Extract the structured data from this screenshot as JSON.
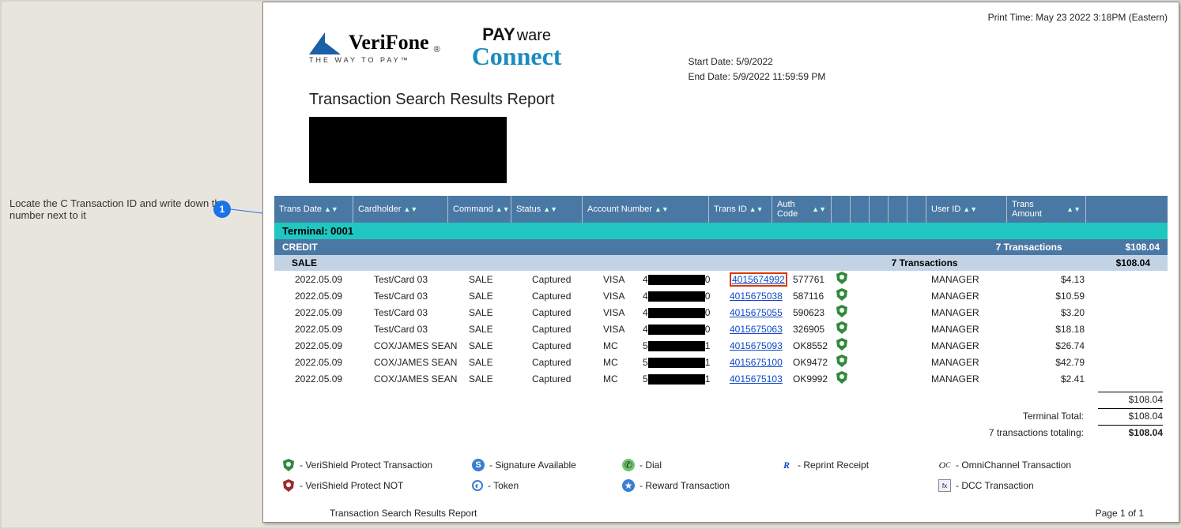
{
  "annotation": {
    "text": "Locate the C Transaction ID and write down the number next to it",
    "marker": "1"
  },
  "print_time": "Print Time: May 23 2022  3:18PM (Eastern)",
  "start_date": "Start Date: 5/9/2022",
  "end_date": "End Date: 5/9/2022 11:59:59 PM",
  "logo_verifone": "VeriFone",
  "logo_verifone_tag": "THE  WAY  TO  PAY™",
  "logo_payware_pay": "PAY",
  "logo_payware_ware": "ware",
  "logo_payware_connect": "Connect",
  "report_title": "Transaction Search Results Report",
  "columns": {
    "trans_date": "Trans Date",
    "cardholder": "Cardholder",
    "command": "Command",
    "status": "Status",
    "account_number": "Account Number",
    "trans_id": "Trans ID",
    "auth_code": "Auth Code",
    "user_id": "User ID",
    "trans_amount": "Trans Amount"
  },
  "terminal_label": "Terminal: 0001",
  "credit_label": "CREDIT",
  "credit_count": "7 Transactions",
  "credit_amount": "$108.04",
  "sale_label": "SALE",
  "sale_count": "7 Transactions",
  "sale_amount": "$108.04",
  "rows": [
    {
      "date": "2022.05.09",
      "holder": "Test/Card 03",
      "cmd": "SALE",
      "status": "Captured",
      "scheme": "VISA",
      "first": "4",
      "last": "0",
      "tid": "4015674992",
      "auth": "577761",
      "user": "MANAGER",
      "amt": "$4.13",
      "boxed": true
    },
    {
      "date": "2022.05.09",
      "holder": "Test/Card 03",
      "cmd": "SALE",
      "status": "Captured",
      "scheme": "VISA",
      "first": "4",
      "last": "0",
      "tid": "4015675038",
      "auth": "587116",
      "user": "MANAGER",
      "amt": "$10.59"
    },
    {
      "date": "2022.05.09",
      "holder": "Test/Card 03",
      "cmd": "SALE",
      "status": "Captured",
      "scheme": "VISA",
      "first": "4",
      "last": "0",
      "tid": "4015675055",
      "auth": "590623",
      "user": "MANAGER",
      "amt": "$3.20"
    },
    {
      "date": "2022.05.09",
      "holder": "Test/Card 03",
      "cmd": "SALE",
      "status": "Captured",
      "scheme": "VISA",
      "first": "4",
      "last": "0",
      "tid": "4015675063",
      "auth": "326905",
      "user": "MANAGER",
      "amt": "$18.18"
    },
    {
      "date": "2022.05.09",
      "holder": "COX/JAMES SEAN",
      "cmd": "SALE",
      "status": "Captured",
      "scheme": "MC",
      "first": "5",
      "last": "1",
      "tid": "4015675093",
      "auth": "OK8552",
      "user": "MANAGER",
      "amt": "$26.74"
    },
    {
      "date": "2022.05.09",
      "holder": "COX/JAMES SEAN",
      "cmd": "SALE",
      "status": "Captured",
      "scheme": "MC",
      "first": "5",
      "last": "1",
      "tid": "4015675100",
      "auth": "OK9472",
      "user": "MANAGER",
      "amt": "$42.79"
    },
    {
      "date": "2022.05.09",
      "holder": "COX/JAMES SEAN",
      "cmd": "SALE",
      "status": "Captured",
      "scheme": "MC",
      "first": "5",
      "last": "1",
      "tid": "4015675103",
      "auth": "OK9992",
      "user": "MANAGER",
      "amt": "$2.41"
    }
  ],
  "subtotal": "$108.04",
  "terminal_total_label": "Terminal Total:",
  "terminal_total": "$108.04",
  "grand_label": "7 transactions  totaling:",
  "grand_total": "$108.04",
  "legend": {
    "vsp": "- VeriShield Protect Transaction",
    "vsp_not": "- VeriShield Protect NOT",
    "sig": "- Signature Available",
    "token": "- Token",
    "dial": "- Dial",
    "reward": "- Reward Transaction",
    "reprint": "- Reprint Receipt",
    "omni": "- OmniChannel Transaction",
    "dcc": "- DCC Transaction"
  },
  "footer_title": "Transaction Search Results Report",
  "footer_page": "Page 1 of 1"
}
